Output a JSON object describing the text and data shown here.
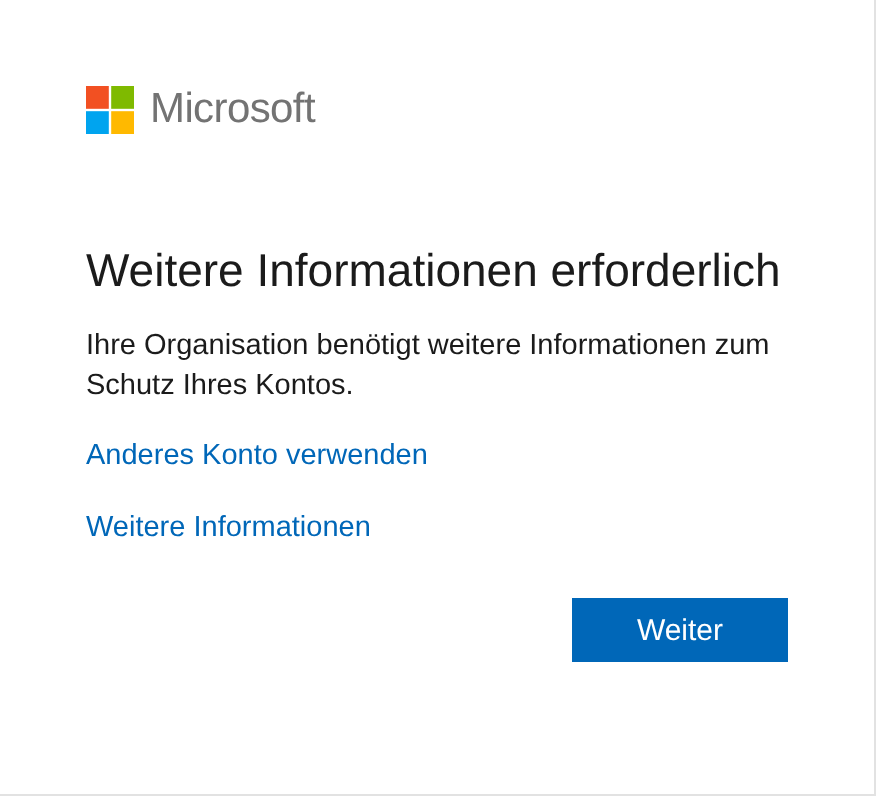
{
  "logo": {
    "text": "Microsoft"
  },
  "title": "Weitere Informationen erforderlich",
  "description": "Ihre Organisation benötigt weitere Informationen zum Schutz Ihres Kontos.",
  "links": [
    "Anderes Konto verwenden",
    "Weitere Informationen"
  ],
  "buttons": [
    "Weiter"
  ]
}
